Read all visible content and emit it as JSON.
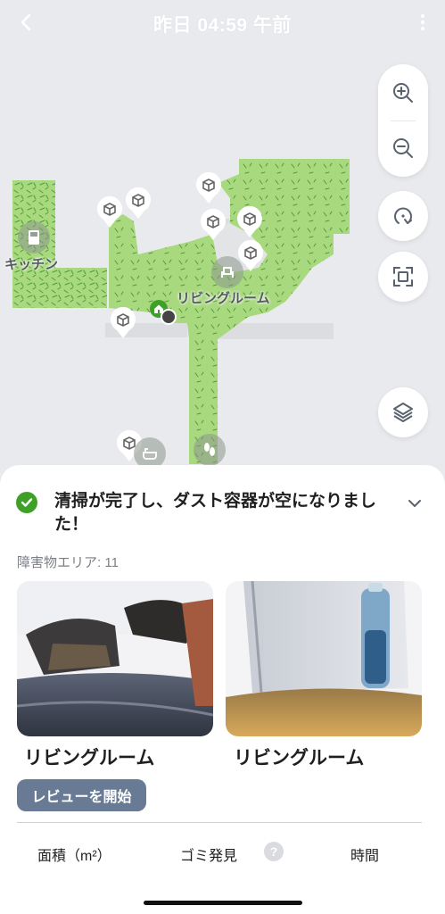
{
  "header": {
    "title": "昨日 04:59 午前"
  },
  "map": {
    "rooms": [
      {
        "label": "キッチン"
      },
      {
        "label": "リビングルーム"
      }
    ],
    "colors": {
      "floor": "#a8d97e",
      "floor_texture": "#4f9a3a",
      "background": "#e9eaee"
    },
    "controls": [
      "zoom-in-icon",
      "zoom-out-icon",
      "rotate-icon",
      "fit-screen-icon",
      "layers-icon"
    ]
  },
  "sheet": {
    "status": "清掃が完了し、ダスト容器が空になりました！",
    "obstacle_area": "障害物エリア: 11",
    "photos": [
      {
        "label": "リビングルーム"
      },
      {
        "label": "リビングルーム"
      }
    ],
    "review_button": "レビューを開始",
    "stats": {
      "area": "面積（m²）",
      "debris": "ゴミ発見",
      "help": "?",
      "time": "時間"
    },
    "colors": {
      "accent": "#3fa028",
      "button": "#697a94"
    }
  }
}
